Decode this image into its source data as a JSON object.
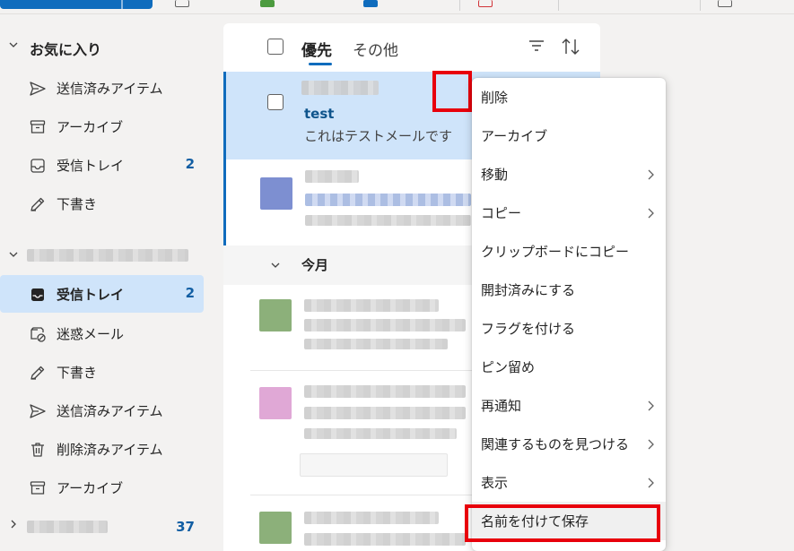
{
  "sidebar": {
    "favorites_header": "お気に入り",
    "favorites": [
      {
        "label": "送信済みアイテム",
        "icon": "send-icon",
        "count": ""
      },
      {
        "label": "アーカイブ",
        "icon": "archive-icon",
        "count": ""
      },
      {
        "label": "受信トレイ",
        "icon": "inbox-icon",
        "count": "2"
      },
      {
        "label": "下書き",
        "icon": "draft-icon",
        "count": ""
      }
    ],
    "account_folders": [
      {
        "label": "受信トレイ",
        "icon": "inbox-icon",
        "count": "2",
        "active": true
      },
      {
        "label": "迷惑メール",
        "icon": "junk-icon",
        "count": ""
      },
      {
        "label": "下書き",
        "icon": "draft-icon",
        "count": ""
      },
      {
        "label": "送信済みアイテム",
        "icon": "send-icon",
        "count": ""
      },
      {
        "label": "削除済みアイテム",
        "icon": "trash-icon",
        "count": ""
      },
      {
        "label": "アーカイブ",
        "icon": "archive-icon",
        "count": ""
      }
    ],
    "other_group_count": "37"
  },
  "list": {
    "tab_focused": "優先",
    "tab_other": "その他",
    "selected_message": {
      "subject": "test",
      "preview": "これはテストメールです"
    },
    "section_label": "今月"
  },
  "context_menu": {
    "items": [
      {
        "label": "削除",
        "submenu": false
      },
      {
        "label": "アーカイブ",
        "submenu": false
      },
      {
        "label": "移動",
        "submenu": true
      },
      {
        "label": "コピー",
        "submenu": true
      },
      {
        "label": "クリップボードにコピー",
        "submenu": false
      },
      {
        "label": "開封済みにする",
        "submenu": false
      },
      {
        "label": "フラグを付ける",
        "submenu": false
      },
      {
        "label": "ピン留め",
        "submenu": false
      },
      {
        "label": "再通知",
        "submenu": true
      },
      {
        "label": "関連するものを見つける",
        "submenu": true
      },
      {
        "label": "表示",
        "submenu": true
      },
      {
        "label": "名前を付けて保存",
        "submenu": false
      }
    ]
  },
  "colors": {
    "accent": "#0f6cbd",
    "selected_bg": "#cfe4fa",
    "highlight_red": "#e8000b"
  }
}
